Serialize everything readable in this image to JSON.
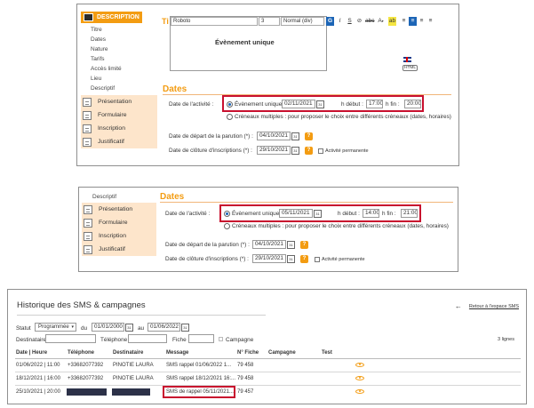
{
  "panel1": {
    "sidebar": {
      "header": "DESCRIPTION",
      "sub_items": [
        "Titre",
        "Dates",
        "Nature",
        "Tarifs",
        "Accès limité",
        "Lieu",
        "Descriptif"
      ],
      "items": [
        "Présentation",
        "Formulaire",
        "Inscription",
        "Justificatif"
      ]
    },
    "editor": {
      "partial_title": "Ti",
      "font": "Roboto",
      "size": "3",
      "style": "Normal (div)",
      "content": "Évènement unique",
      "html_badge": "HTML"
    },
    "dates": {
      "title": "Dates",
      "activity_label": "Date de l'activité :",
      "single_label": "Évènement unique :",
      "single_date": "02/11/2021",
      "start_label": "h début :",
      "start_time": "17:00",
      "end_label": "h fin :",
      "end_time": "20:00",
      "multi_label": "Créneaux multiples :",
      "multi_text": "pour proposer le choix entre différents créneaux (dates, horaires)",
      "pub_label": "Date de départ de la parution (*) :",
      "pub_date": "04/10/2021",
      "close_label": "Date de clôture d'inscriptions (*) :",
      "close_date": "29/10/2021",
      "permanent_label": "Activité permanente"
    }
  },
  "panel2": {
    "sidebar": {
      "sub_items": [
        "Descriptif"
      ],
      "items": [
        "Présentation",
        "Formulaire",
        "Inscription",
        "Justificatif"
      ]
    },
    "dates": {
      "title": "Dates",
      "activity_label": "Date de l'activité :",
      "single_label": "Évènement unique :",
      "single_date": "05/11/2021",
      "start_label": "h début :",
      "start_time": "14:00",
      "end_label": "h fin :",
      "end_time": "21:00",
      "multi_label": "Créneaux multiples :",
      "multi_text": "pour proposer le choix entre différents créneaux (dates, horaires)",
      "pub_label": "Date de départ de la parution (*) :",
      "pub_date": "04/10/2021",
      "close_label": "Date de clôture d'inscriptions (*) :",
      "close_date": "29/10/2021",
      "permanent_label": "Activité permanente"
    }
  },
  "panel3": {
    "title": "Historique des SMS & campagnes",
    "back_link": "Retour à l'espace SMS",
    "filters": {
      "statut_label": "Statut",
      "statut_value": "Programmée",
      "du_label": "du",
      "du_value": "01/01/2000",
      "au_label": "au",
      "au_value": "01/06/2022",
      "destinataire_label": "Destinataire",
      "telephone_label": "Téléphone",
      "fiche_label": "Fiche",
      "campagne_label": "Campagne",
      "count": "3 lignes"
    },
    "columns": [
      "Date | Heure",
      "Téléphone",
      "Destinataire",
      "Message",
      "N° Fiche",
      "Campagne",
      "Test"
    ],
    "rows": [
      {
        "date": "01/06/2022 | 11:00",
        "phone": "+33682077392",
        "dest": "PINOTIE LAURA",
        "msg": "SMS rappel 01/06/2022 1...",
        "fiche": "79 458"
      },
      {
        "date": "18/12/2021 | 16:00",
        "phone": "+33682077392",
        "dest": "PINOTIE LAURA",
        "msg": "SMS rappel 18/12/2021 16:...",
        "fiche": "79 458"
      },
      {
        "date": "25/10/2021 | 20:00",
        "phone": "",
        "dest": "",
        "msg": "SMS de rappel 05/11/2021...",
        "fiche": "79 457"
      }
    ]
  },
  "colors": {
    "accent": "#f39c12",
    "highlight": "#c8102e",
    "sidebar_bg": "#fde5cb",
    "redacted": "#2c3148"
  }
}
